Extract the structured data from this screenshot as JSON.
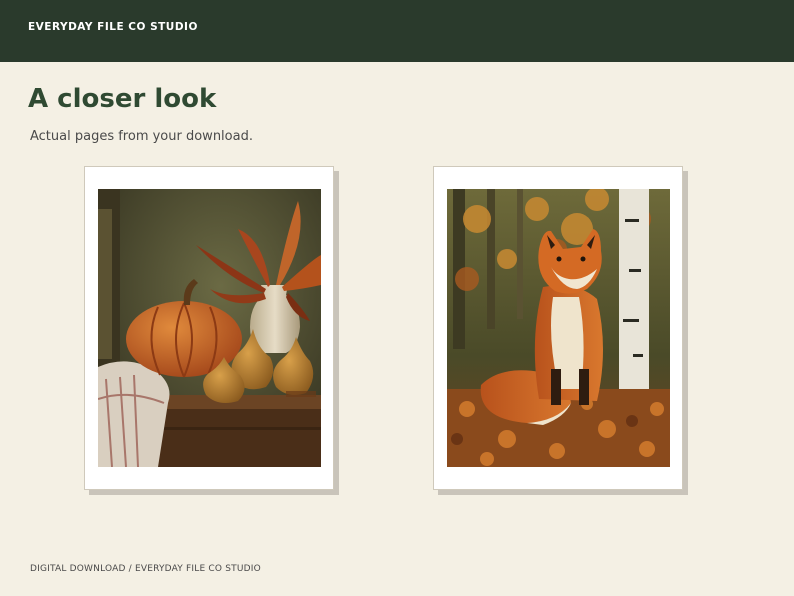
{
  "header": {
    "brand": "EVERYDAY FILE CO STUDIO"
  },
  "main": {
    "title": "A closer look",
    "subtitle": "Actual pages from your download.",
    "previews": [
      {
        "subject": "autumn still life with pumpkin, pears, ceramic vase and oak leaves"
      },
      {
        "subject": "red fox sitting among autumn leaves beside birch trees"
      }
    ]
  },
  "footer": {
    "text": "DIGITAL DOWNLOAD / EVERYDAY FILE CO STUDIO"
  },
  "colors": {
    "header_bg": "#2a3a2c",
    "page_bg": "#f4f0e4",
    "title": "#2f4a32"
  }
}
